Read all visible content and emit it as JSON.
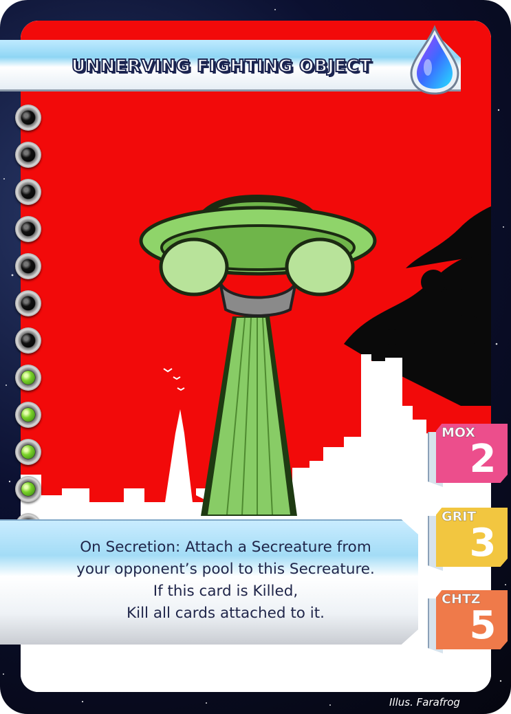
{
  "card": {
    "title": "UNNERVING FIGHTING OBJECT",
    "element_icon": "water-drop-icon",
    "cost": {
      "total_gems": 12,
      "filled_gems": 5
    },
    "rules_text": [
      "On Secretion: Attach a Secreature from",
      "your opponent’s pool to this Secreature.",
      "If this card is Killed,",
      "Kill all cards attached to it."
    ],
    "stats": [
      {
        "label": "MOX",
        "value": "2",
        "color": "#ec4e8c"
      },
      {
        "label": "GRIT",
        "value": "3",
        "color": "#f2c640"
      },
      {
        "label": "CHTZ",
        "value": "5",
        "color": "#ef7a4a"
      }
    ],
    "credit": "Illus. Farafrog"
  },
  "colors": {
    "art_background": "#f20a0a",
    "ufo_green": "#8fd46a",
    "beam_green": "#88cc66",
    "text_navy": "#20264a"
  }
}
